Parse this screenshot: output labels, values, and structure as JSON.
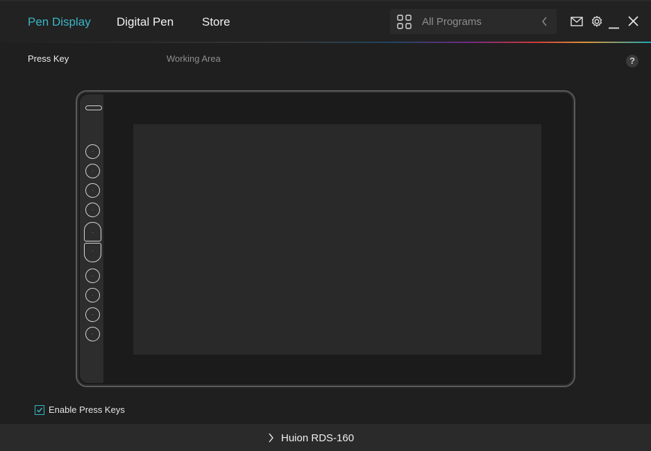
{
  "nav": {
    "tabs": [
      {
        "label": "Pen Display",
        "active": true
      },
      {
        "label": "Digital Pen",
        "active": false
      },
      {
        "label": "Store",
        "active": false
      }
    ]
  },
  "program_selector": {
    "icon": "grid-icon",
    "label": "All Programs",
    "chevron": "chevron-left-icon"
  },
  "window_controls": [
    "mail-icon",
    "gear-icon",
    "minimize-icon",
    "close-icon"
  ],
  "subtabs": [
    {
      "label": "Press Key",
      "active": true
    },
    {
      "label": "Working Area",
      "active": false
    }
  ],
  "help": {
    "label": "?"
  },
  "tablet": {
    "press_keys_count": 10,
    "key_shapes": [
      "circle",
      "circle",
      "circle",
      "circle",
      "pill-top",
      "pill-bottom",
      "circle",
      "circle",
      "circle",
      "circle"
    ]
  },
  "settings": {
    "enable_press_keys": {
      "label": "Enable Press Keys",
      "checked": true
    }
  },
  "footer": {
    "device_name": "Huion RDS-160"
  },
  "colors": {
    "accent": "#39b7c6",
    "background": "#1f1f1f",
    "topbar": "#222222",
    "text": "#e6e6e6",
    "muted": "#8e8e8e"
  }
}
